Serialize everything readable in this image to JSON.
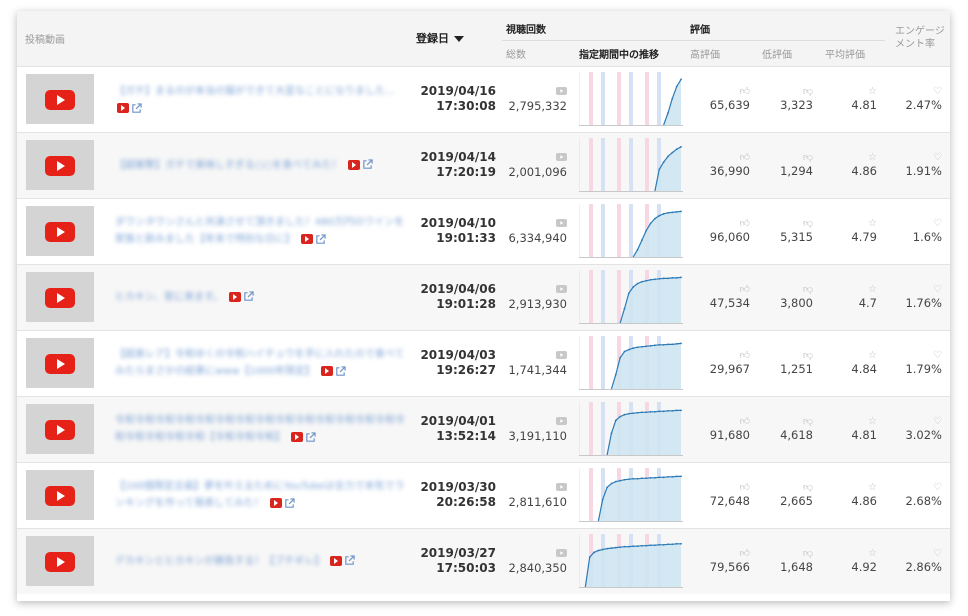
{
  "header": {
    "video": "投稿動画",
    "date": "登録日",
    "views_group": "視聴回数",
    "views_total": "総数",
    "views_trend": "指定期間中の推移",
    "rating_group": "評価",
    "likes": "高評価",
    "dislikes": "低評価",
    "avg_rating": "平均評価",
    "engagement": "エンゲージメント率"
  },
  "icons": {
    "play": "youtube-play-icon",
    "external": "external-link-icon",
    "views": "video-icon",
    "like": "thumbs-up-icon",
    "dislike": "thumbs-down-icon",
    "star": "star-icon",
    "engagement": "heart-hands-icon"
  },
  "colors": {
    "youtube_red": "#e62117",
    "trend_fill": "#cfe6f2",
    "trend_line": "#2b7ab6",
    "band_pink": "#f6d7e3",
    "band_blue": "#d6e2f4",
    "link_blue": "#7fa4d6"
  },
  "rows": [
    {
      "title": "【ガチ】まるのが本当の猫ができて大変なことになりました…",
      "date": "2019/04/16",
      "time": "17:30:08",
      "views": "2,795,332",
      "likes": "65,639",
      "dislikes": "3,323",
      "rating": "4.81",
      "engagement": "2.47%",
      "trend": [
        0,
        0,
        0,
        0,
        0,
        0,
        0,
        0,
        0,
        0,
        0,
        0,
        0,
        0,
        0,
        0,
        0,
        0,
        0,
        0,
        0.25,
        0.55,
        0.8,
        0.95
      ]
    },
    {
      "title": "【超衝撃】ガチで美味しすぎる○○を食べてみた！",
      "date": "2019/04/14",
      "time": "17:20:19",
      "views": "2,001,096",
      "likes": "36,990",
      "dislikes": "1,294",
      "rating": "4.86",
      "engagement": "1.91%",
      "trend": [
        0,
        0,
        0,
        0,
        0,
        0,
        0,
        0,
        0,
        0,
        0,
        0,
        0,
        0,
        0,
        0,
        0,
        0,
        0.45,
        0.6,
        0.72,
        0.8,
        0.87,
        0.92
      ]
    },
    {
      "title": "ダウンタウンさんと共演させて頂きました！480万円のワインを家族と飲みました【年末で特別な日に】",
      "date": "2019/04/10",
      "time": "19:01:33",
      "views": "6,334,940",
      "likes": "96,060",
      "dislikes": "5,315",
      "rating": "4.79",
      "engagement": "1.6%",
      "trend": [
        0,
        0,
        0,
        0,
        0,
        0,
        0,
        0,
        0,
        0,
        0,
        0,
        0,
        0.15,
        0.35,
        0.55,
        0.7,
        0.8,
        0.86,
        0.9,
        0.92,
        0.93,
        0.94,
        0.95
      ]
    },
    {
      "title": "ヒカキン、家に来ます。",
      "date": "2019/04/06",
      "time": "19:01:28",
      "views": "2,913,930",
      "likes": "47,534",
      "dislikes": "3,800",
      "rating": "4.7",
      "engagement": "1.76%",
      "trend": [
        0,
        0,
        0,
        0,
        0,
        0,
        0,
        0,
        0,
        0,
        0.3,
        0.62,
        0.75,
        0.82,
        0.86,
        0.88,
        0.9,
        0.91,
        0.92,
        0.93,
        0.93,
        0.94,
        0.94,
        0.95
      ]
    },
    {
      "title": "【超美レア】令和ゆくの令和ハイチュウを手に入れたので食べてみたらまさかの結果にwww【1000年限定】",
      "date": "2019/04/03",
      "time": "19:26:27",
      "views": "1,741,344",
      "likes": "29,967",
      "dislikes": "1,251",
      "rating": "4.84",
      "engagement": "1.79%",
      "trend": [
        0,
        0,
        0,
        0,
        0,
        0,
        0,
        0,
        0.3,
        0.65,
        0.78,
        0.82,
        0.85,
        0.87,
        0.88,
        0.89,
        0.9,
        0.91,
        0.92,
        0.92,
        0.93,
        0.93,
        0.94,
        0.95
      ]
    },
    {
      "title": "令和令和令和令和令和令和令和令和令和令和令和令和令和令和令和令和令和令和令和【令和令和令和】",
      "date": "2019/04/01",
      "time": "13:52:14",
      "views": "3,191,110",
      "likes": "91,680",
      "dislikes": "4,618",
      "rating": "4.81",
      "engagement": "3.02%",
      "trend": [
        0,
        0,
        0,
        0,
        0,
        0,
        0,
        0.45,
        0.72,
        0.8,
        0.84,
        0.86,
        0.87,
        0.88,
        0.89,
        0.89,
        0.9,
        0.9,
        0.91,
        0.91,
        0.92,
        0.92,
        0.93,
        0.93
      ]
    },
    {
      "title": "【100個限定企画】夢を叶えるためにYouTubeは全力で本気でランキングを作って発表してみた！",
      "date": "2019/03/30",
      "time": "20:26:58",
      "views": "2,811,610",
      "likes": "72,648",
      "dislikes": "2,665",
      "rating": "4.86",
      "engagement": "2.68%",
      "trend": [
        0,
        0,
        0,
        0,
        0,
        0.45,
        0.7,
        0.78,
        0.82,
        0.84,
        0.86,
        0.87,
        0.88,
        0.88,
        0.89,
        0.89,
        0.9,
        0.9,
        0.91,
        0.91,
        0.92,
        0.92,
        0.93,
        0.93
      ]
    },
    {
      "title": "デカキンとヒカキンが勝負する！【ブチギレ】",
      "date": "2019/03/27",
      "time": "17:50:03",
      "views": "2,840,350",
      "likes": "79,566",
      "dislikes": "1,648",
      "rating": "4.92",
      "engagement": "2.86%",
      "trend": [
        0,
        0,
        0.62,
        0.72,
        0.76,
        0.78,
        0.8,
        0.81,
        0.82,
        0.83,
        0.84,
        0.84,
        0.85,
        0.85,
        0.86,
        0.86,
        0.87,
        0.87,
        0.88,
        0.88,
        0.89,
        0.89,
        0.9,
        0.9
      ]
    }
  ]
}
